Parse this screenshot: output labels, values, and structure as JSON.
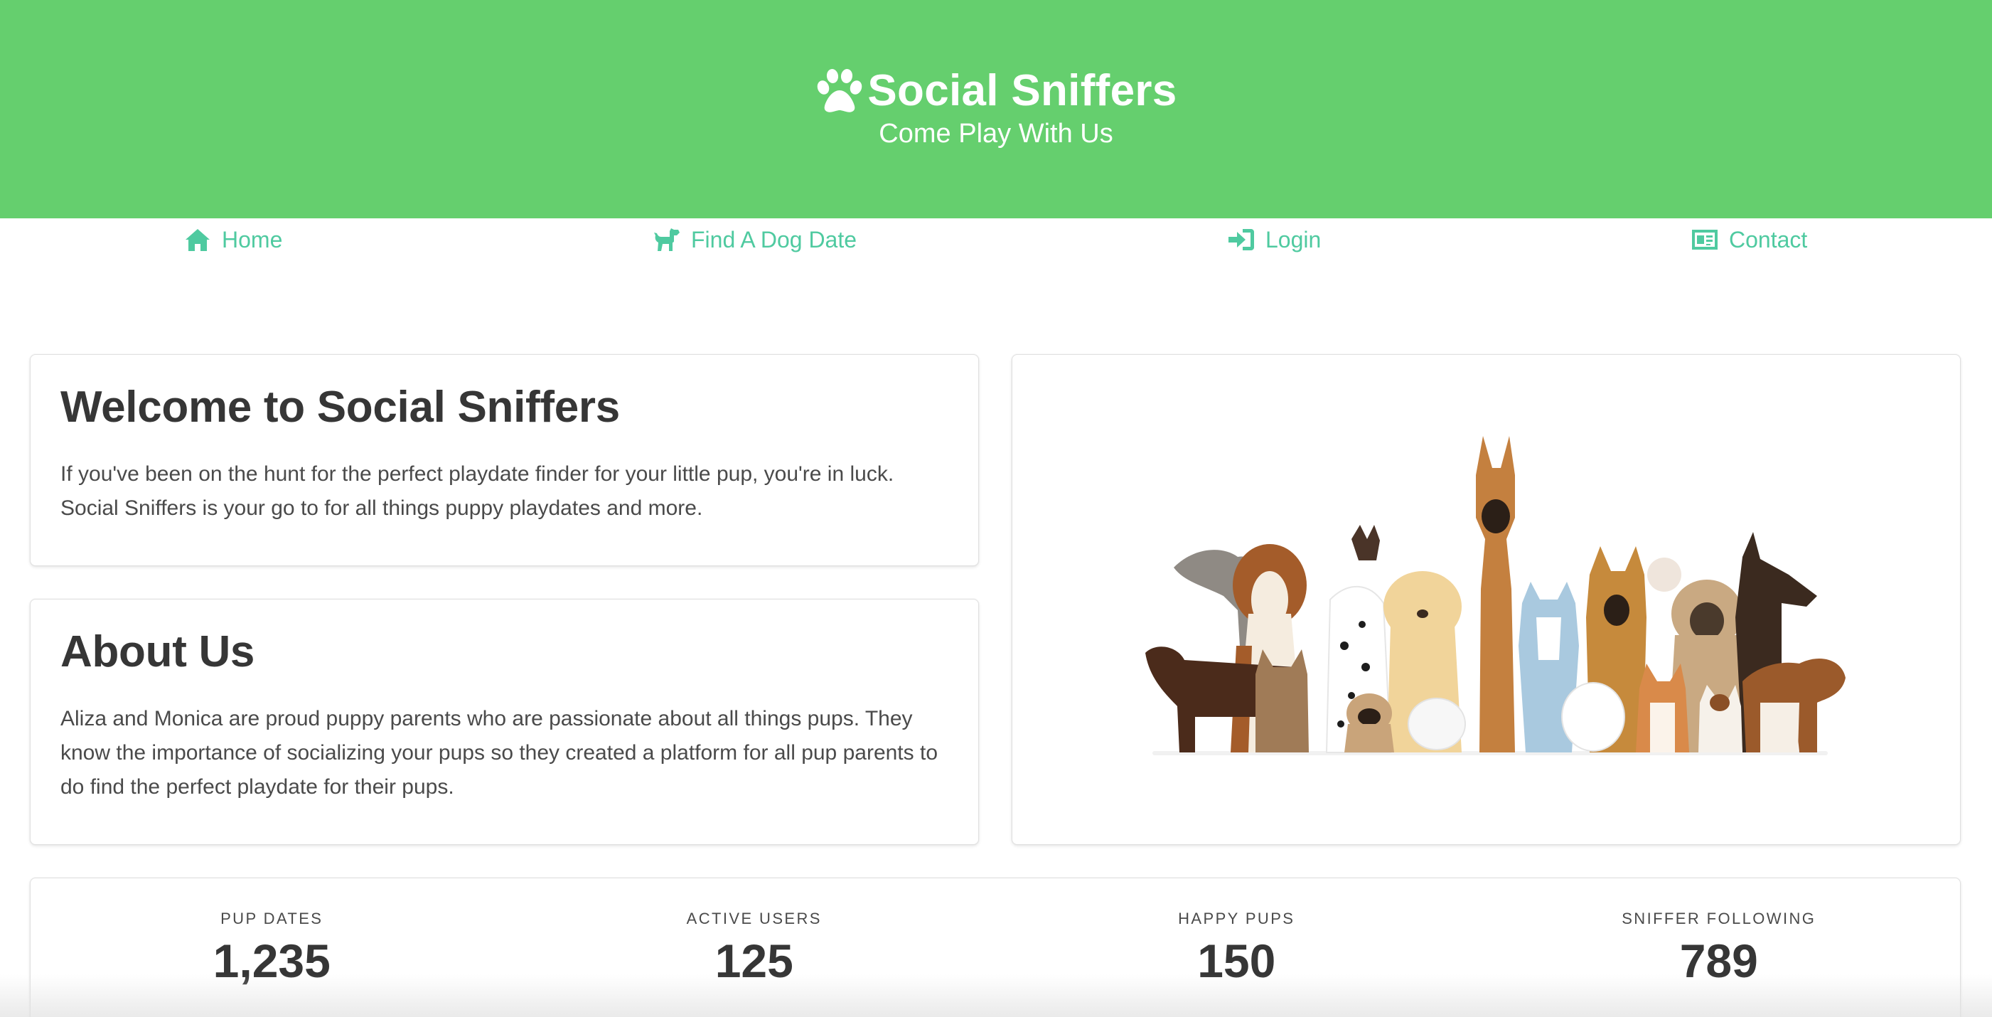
{
  "theme": {
    "accent": "#65cf6e",
    "link": "#4fcaa0"
  },
  "header": {
    "title": "Social Sniffers",
    "subtitle": "Come Play With Us",
    "logo_icon": "paw-icon"
  },
  "nav": {
    "items": [
      {
        "label": "Home",
        "icon": "home-icon"
      },
      {
        "label": "Find A Dog Date",
        "icon": "dog-icon"
      },
      {
        "label": "Login",
        "icon": "sign-in-icon"
      },
      {
        "label": "Contact",
        "icon": "id-card-icon"
      }
    ]
  },
  "welcome": {
    "heading": "Welcome to Social Sniffers",
    "body": "If you've been on the hunt for the perfect playdate finder for your little pup, you're in luck. Social Sniffers is your go to for all things puppy playdates and more."
  },
  "about": {
    "heading": "About Us",
    "body": "Aliza and Monica are proud puppy parents who are passionate about all things pups. They know the importance of socializing your pups so they created a platform for all pup parents to do find the perfect playdate for their pups."
  },
  "image": {
    "subject": "group-of-dogs-illustration"
  },
  "stats": [
    {
      "label": "PUP DATES",
      "value": "1,235"
    },
    {
      "label": "ACTIVE USERS",
      "value": "125"
    },
    {
      "label": "HAPPY PUPS",
      "value": "150"
    },
    {
      "label": "SNIFFER FOLLOWING",
      "value": "789"
    }
  ]
}
